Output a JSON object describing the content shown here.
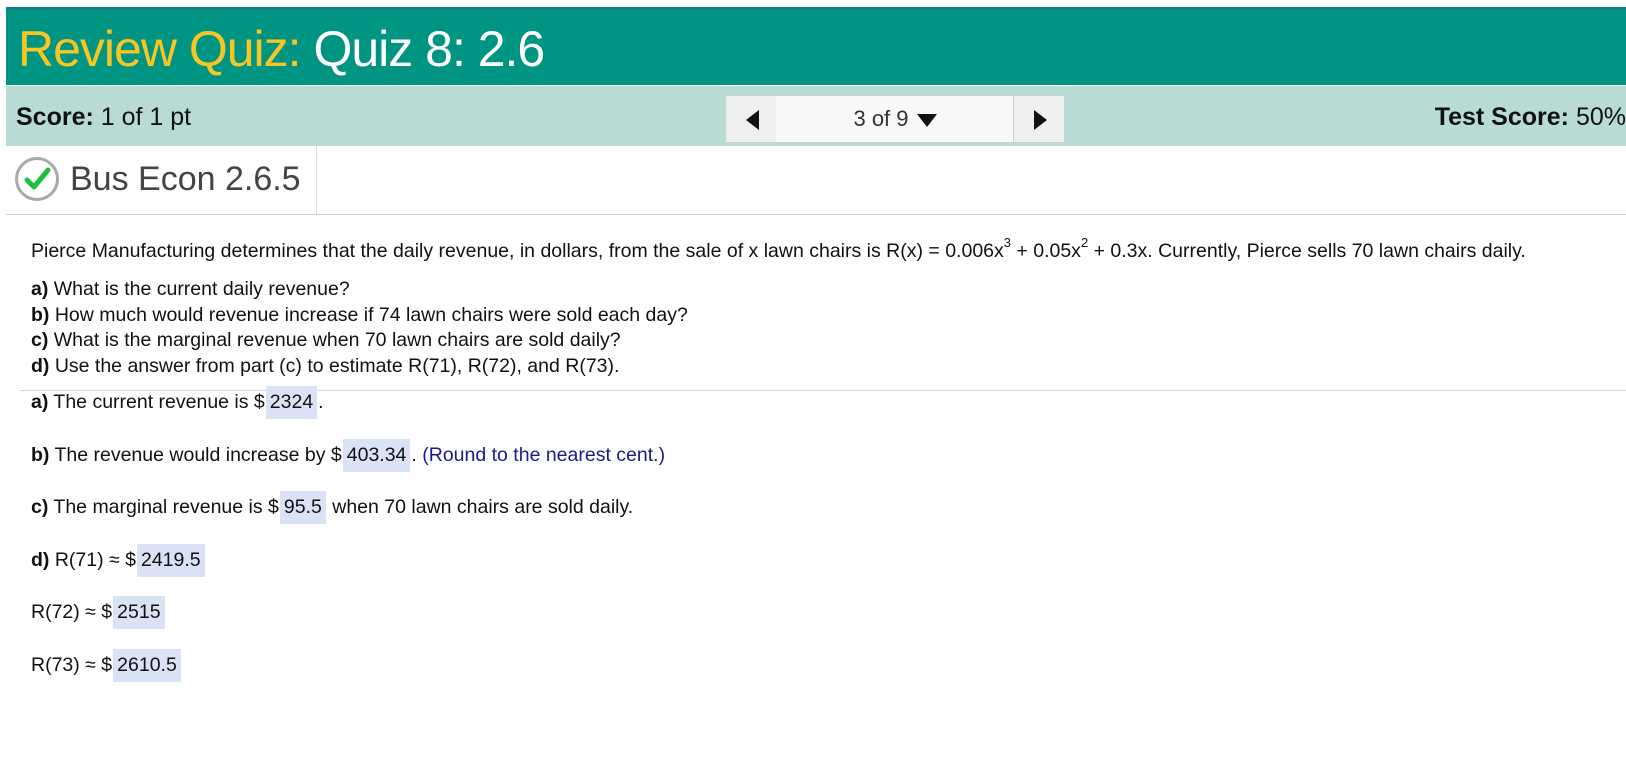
{
  "header": {
    "title_prefix": "Review Quiz:",
    "title_main": "Quiz 8: 2.6"
  },
  "score_bar": {
    "score_label": "Score:",
    "score_value": "1 of 1 pt",
    "test_score_label": "Test Score:",
    "test_score_value": "50%",
    "nav": {
      "position": "3 of 9"
    }
  },
  "question": {
    "status": "correct",
    "title": "Bus Econ 2.6.5",
    "problem": {
      "lead": "Pierce Manufacturing determines that the daily revenue, in dollars, from the sale of x lawn chairs is R(x) = 0.006x",
      "exp1": "3",
      "mid": " + 0.05x",
      "exp2": "2",
      "tail": " + 0.3x. Currently, Pierce sells 70 lawn chairs daily."
    },
    "parts": [
      {
        "label": "a)",
        "text": "What is the current daily revenue?"
      },
      {
        "label": "b)",
        "text": "How much would revenue increase if 74 lawn chairs were sold each day?"
      },
      {
        "label": "c)",
        "text": "What is the marginal revenue when 70 lawn chairs are sold daily?"
      },
      {
        "label": "d)",
        "text": "Use the answer from part (c) to estimate R(71), R(72), and R(73)."
      }
    ],
    "answers": {
      "a": {
        "label": "a)",
        "pre": "The current revenue is $",
        "value": "2324",
        "post": "."
      },
      "b": {
        "label": "b)",
        "pre": "The revenue would increase by $",
        "value": "403.34",
        "post": ".",
        "note": "(Round to the nearest cent.)"
      },
      "c": {
        "label": "c)",
        "pre": "The marginal revenue is $",
        "value": "95.5",
        "post": "when 70 lawn chairs are sold daily."
      },
      "d": {
        "label": "d)",
        "pre": "R(71) ≈ $",
        "value": "2419.5"
      },
      "d2": {
        "pre": "R(72) ≈ $",
        "value": "2515"
      },
      "d3": {
        "pre": "R(73) ≈ $",
        "value": "2610.5"
      }
    }
  },
  "colors": {
    "title_bar": "#009483",
    "title_prefix": "#f7c623",
    "score_bar": "#b8dbd6",
    "answer_box": "#d9e3f5",
    "check": "#1fbf3a"
  },
  "icons": {
    "status": "check-icon",
    "prev": "triangle-left-icon",
    "next": "triangle-right-icon",
    "dropdown": "caret-down-icon"
  }
}
